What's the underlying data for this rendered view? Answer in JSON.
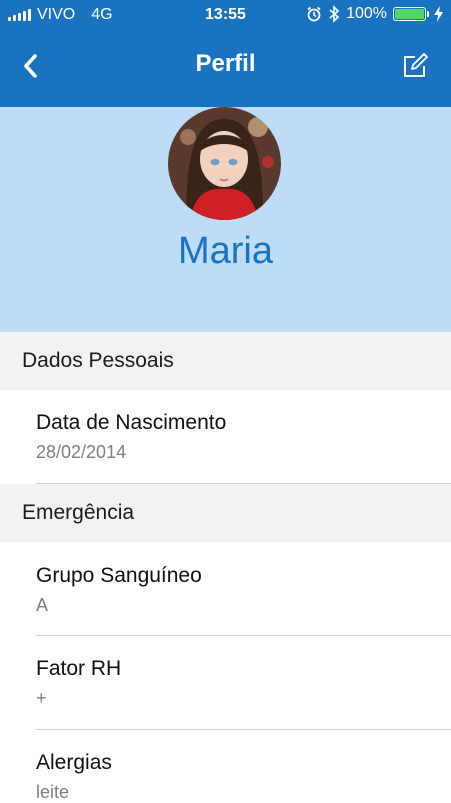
{
  "status_bar": {
    "carrier": "VIVO",
    "network": "4G",
    "time": "13:55",
    "battery_percent": "100%",
    "battery_level": 1.0,
    "icons": [
      "signal-icon",
      "alarm-icon",
      "bluetooth-icon",
      "battery-icon",
      "charging-bolt-icon"
    ]
  },
  "navbar": {
    "title": "Perfil",
    "back_icon": "chevron-left-icon",
    "edit_icon": "edit-icon"
  },
  "profile": {
    "name": "Maria"
  },
  "sections": [
    {
      "header": "Dados Pessoais",
      "rows": [
        {
          "label": "Data de Nascimento",
          "value": "28/02/2014"
        }
      ]
    },
    {
      "header": "Emergência",
      "rows": [
        {
          "label": "Grupo Sanguíneo",
          "value": "A"
        },
        {
          "label": "Fator RH",
          "value": "+"
        },
        {
          "label": "Alergias",
          "value": "leite"
        }
      ]
    }
  ],
  "colors": {
    "primary": "#1a73c0",
    "hero_background": "#bcdcf7",
    "section_background": "#f2f2f2",
    "battery_fill": "#4cd964"
  }
}
